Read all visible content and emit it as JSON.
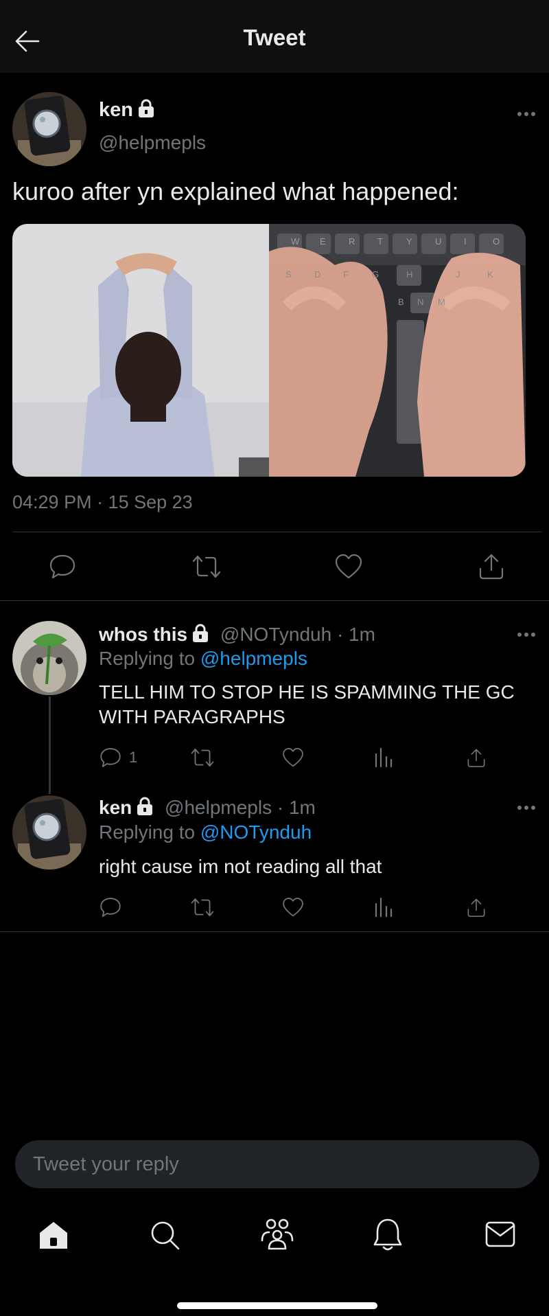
{
  "header": {
    "title": "Tweet"
  },
  "main_tweet": {
    "display_name": "ken",
    "handle": "@helpmepls",
    "text": "kuroo after yn explained what happened:",
    "timestamp": "04:29 PM · 15 Sep 23",
    "keyboard_keys_row1": [
      "W",
      "E",
      "R",
      "T",
      "Y",
      "U",
      "I",
      "O"
    ],
    "keyboard_keys_row2": [
      "S",
      "D",
      "F",
      "G",
      "H",
      "J",
      "K"
    ],
    "keyboard_keys_row3": [
      "B",
      "N",
      "M"
    ]
  },
  "replies": [
    {
      "display_name": "whos this",
      "handle_time": "@NOTynduh · 1m",
      "replying_prefix": "Replying to",
      "replying_to": "@helpmepls",
      "text": "TELL HIM TO STOP HE IS SPAMMING THE GC WITH PARAGRAPHS",
      "reply_count": "1"
    },
    {
      "display_name": "ken",
      "handle_time": "@helpmepls · 1m",
      "replying_prefix": "Replying to",
      "replying_to": "@NOTynduh",
      "text": "right cause im not reading all that",
      "reply_count": ""
    }
  ],
  "composer": {
    "placeholder": "Tweet your reply"
  },
  "bottom_nav": [
    "home-icon",
    "search-icon",
    "communities-icon",
    "notifications-icon",
    "messages-icon"
  ],
  "colors": {
    "background": "#000000",
    "text": "#e7e9ea",
    "muted": "#71767b",
    "link": "#1d9bf0"
  }
}
